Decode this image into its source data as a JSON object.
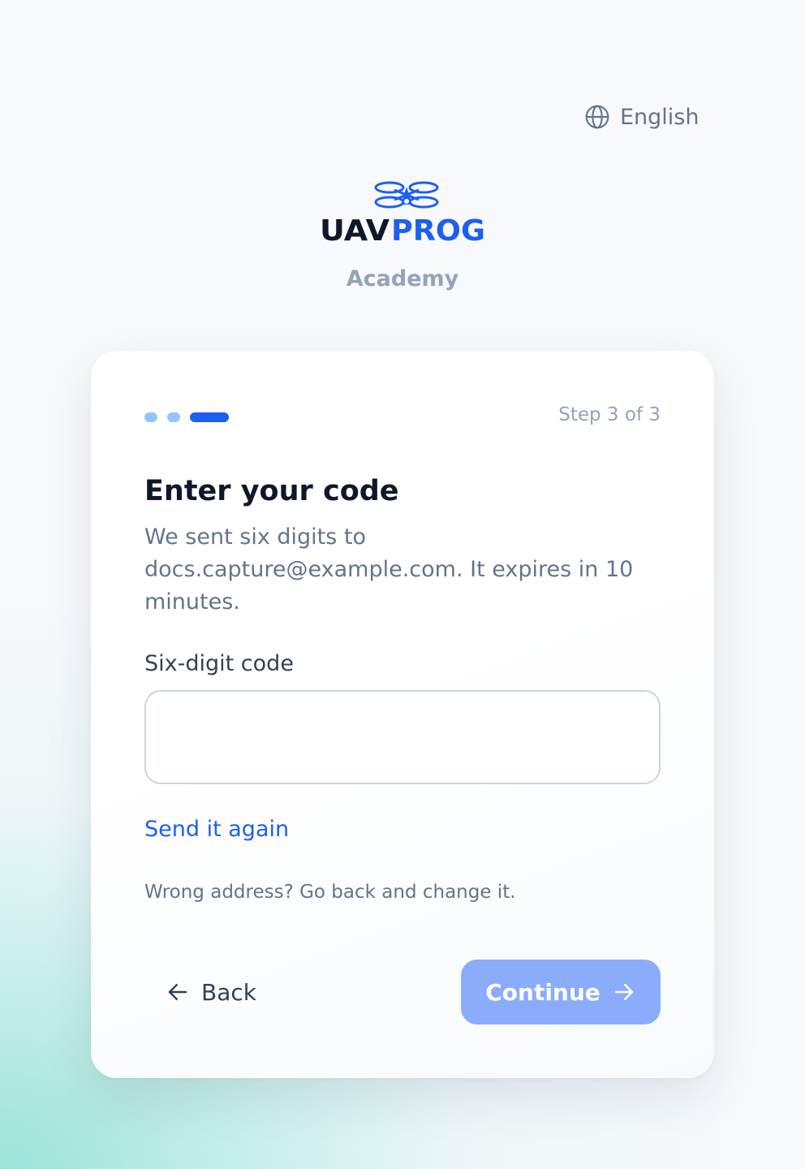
{
  "language": {
    "label": "English",
    "icon": "globe-icon"
  },
  "brand": {
    "logo_left": "UAV",
    "logo_right": "PROG",
    "subtitle": "Academy",
    "colors": {
      "dark": "#0f172a",
      "accent": "#1d5ff0"
    }
  },
  "progress": {
    "total_steps": 3,
    "current_step": 3,
    "label": "Step 3 of 3"
  },
  "form": {
    "title": "Enter your code",
    "description": "We sent six digits to docs.capture@example.com. It expires in 10 minutes.",
    "code_label": "Six-digit code",
    "code_value": "",
    "resend_label": "Send it again",
    "wrong_address_text": "Wrong address? Go back and change it."
  },
  "actions": {
    "back_label": "Back",
    "back_icon": "arrow-left-icon",
    "continue_label": "Continue",
    "continue_icon": "arrow-right-icon",
    "continue_color": "#8aacfb"
  }
}
